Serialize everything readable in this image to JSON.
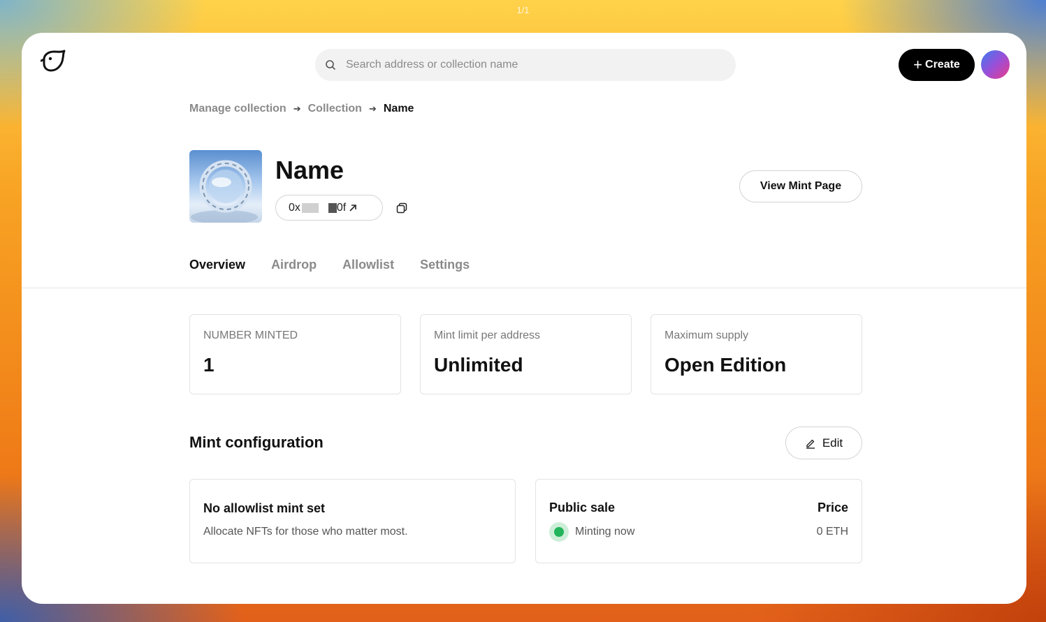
{
  "page_indicator": "1/1",
  "header": {
    "search_placeholder": "Search address or collection name",
    "create_label": "Create",
    "create_icon": "plus-icon",
    "logo_icon": "bird-logo-icon",
    "search_icon": "search-icon"
  },
  "breadcrumb": [
    "Manage collection",
    "Collection",
    "Name"
  ],
  "collection": {
    "name": "Name",
    "address_prefix": "0x",
    "address_suffix": "0f",
    "address_link_icon": "external-link-icon",
    "copy_icon": "copy-icon"
  },
  "view_mint_label": "View Mint Page",
  "tabs": [
    {
      "label": "Overview",
      "active": true
    },
    {
      "label": "Airdrop",
      "active": false
    },
    {
      "label": "Allowlist",
      "active": false
    },
    {
      "label": "Settings",
      "active": false
    }
  ],
  "stats": [
    {
      "label": "NUMBER MINTED",
      "value": "1"
    },
    {
      "label": "Mint limit per address",
      "value": "Unlimited"
    },
    {
      "label": "Maximum supply",
      "value": "Open Edition"
    }
  ],
  "mint_config": {
    "title": "Mint configuration",
    "edit_label": "Edit",
    "edit_icon": "pencil-icon",
    "allowlist_card": {
      "title": "No allowlist mint set",
      "description": "Allocate NFTs for those who matter most."
    },
    "public_sale_card": {
      "title": "Public sale",
      "price_header": "Price",
      "status": "Minting now",
      "price": "0 ETH",
      "status_color": "#22b45a"
    }
  },
  "colors": {
    "primary_button": "#000000",
    "muted_text": "#8a8a8a",
    "border": "#e3e3e3"
  }
}
